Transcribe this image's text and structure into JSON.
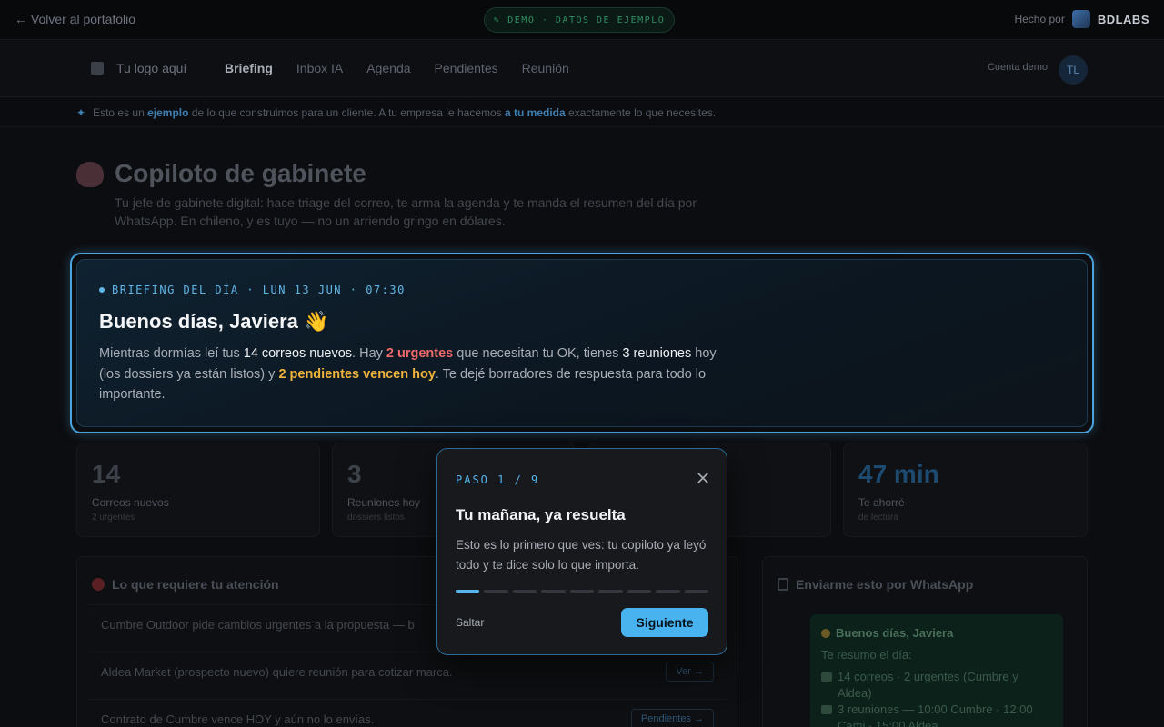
{
  "topbar": {
    "back_label": "← Volver al portafolio",
    "demo_label": "DEMO · DATOS DE EJEMPLO",
    "made_by_label": "Hecho por",
    "brand": "BDLABS"
  },
  "nav": {
    "logo_label": "Tu logo aquí",
    "items": [
      "Briefing",
      "Inbox IA",
      "Agenda",
      "Pendientes",
      "Reunión"
    ],
    "account_label": "Cuenta demo",
    "avatar_initials": "TL"
  },
  "banner": {
    "p1": "Esto es un ",
    "h1": "ejemplo",
    "p2": " de lo que construimos para un cliente. A tu empresa le hacemos ",
    "h2": "a tu medida",
    "p3": " exactamente lo que necesites."
  },
  "page": {
    "title": "Copiloto de gabinete",
    "subtitle": "Tu jefe de gabinete digital: hace triage del correo, te arma la agenda y te manda el resumen del día por WhatsApp. En chileno, y es tuyo — no un arriendo gringo en dólares."
  },
  "briefing": {
    "tag": "BRIEFING DEL DÍA · LUN 13 JUN · 07:30",
    "greeting": "Buenos días, Javiera 👋",
    "b1": "Mientras dormías leí tus ",
    "b2": "14 correos nuevos",
    "b3": ". Hay ",
    "b4": "2 urgentes",
    "b5": " que necesitan tu OK, tienes ",
    "b6": "3 reuniones",
    "b7": " hoy (los dossiers ya están listos) y ",
    "b8": "2 pendientes vencen hoy",
    "b9": ". Te dejé borradores de respuesta para todo lo importante."
  },
  "stats": [
    {
      "num": "14",
      "label": "Correos nuevos",
      "sub": "2 urgentes"
    },
    {
      "num": "3",
      "label": "Reuniones hoy",
      "sub": "dossiers listos"
    },
    {
      "num": "47 min",
      "label": "Te ahorré",
      "sub": "de lectura"
    }
  ],
  "attention": {
    "title": "Lo que requiere tu atención",
    "rows": [
      {
        "text": "Cumbre Outdoor pide cambios urgentes a la propuesta — b",
        "action": ""
      },
      {
        "text": "Aldea Market (prospecto nuevo) quiere reunión para cotizar marca.",
        "action": "Ver →"
      },
      {
        "text": "Contrato de Cumbre vence HOY y aún no lo envías.",
        "action": "Pendientes →"
      }
    ]
  },
  "whatsapp": {
    "title": "Enviarme esto por WhatsApp",
    "header": "Buenos días, Javiera",
    "intro": "Te resumo el día:",
    "line1": "14 correos · 2 urgentes (Cumbre y Aldea)",
    "line2": "3 reuniones — 10:00 Cumbre · 12:00 Cami · 15:00 Aldea"
  },
  "tour": {
    "step": "PASO 1 / 9",
    "title": "Tu mañana, ya resuelta",
    "body": "Esto es lo primero que ves: tu copiloto ya leyó todo y te dice solo lo que importa.",
    "skip": "Saltar",
    "next": "Siguiente",
    "current_step": 1,
    "total_steps": 9
  },
  "colors": {
    "accent": "#49b3ef",
    "urgent": "#f06a6a",
    "warning": "#f0b43c"
  }
}
